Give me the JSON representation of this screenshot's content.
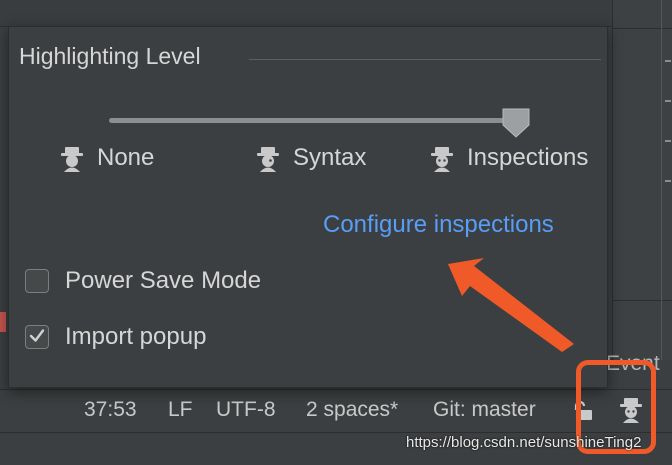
{
  "popup": {
    "title": "Highlighting Level",
    "levels": [
      {
        "label": "None"
      },
      {
        "label": "Syntax"
      },
      {
        "label": "Inspections"
      }
    ],
    "slider_selected_level": "Inspections",
    "configure_link": "Configure inspections",
    "power_save": {
      "label": "Power Save Mode",
      "checked": false
    },
    "import_popup": {
      "label": "Import popup",
      "checked": true
    }
  },
  "status_bar": {
    "position": "37:53",
    "line_separator": "LF",
    "encoding": "UTF-8",
    "indent": "2 spaces*",
    "vcs_branch": "Git: master",
    "lock_icon": "lock-icon",
    "inspector_icon": "hector-icon"
  },
  "background": {
    "event_log_label": "Event"
  },
  "annotation": {
    "highlight_color": "#f05a28",
    "watermark": "https://blog.csdn.net/sunshineTing2"
  },
  "colors": {
    "background": "#3c3f41",
    "link": "#589df6",
    "text": "#d6d6d6"
  }
}
